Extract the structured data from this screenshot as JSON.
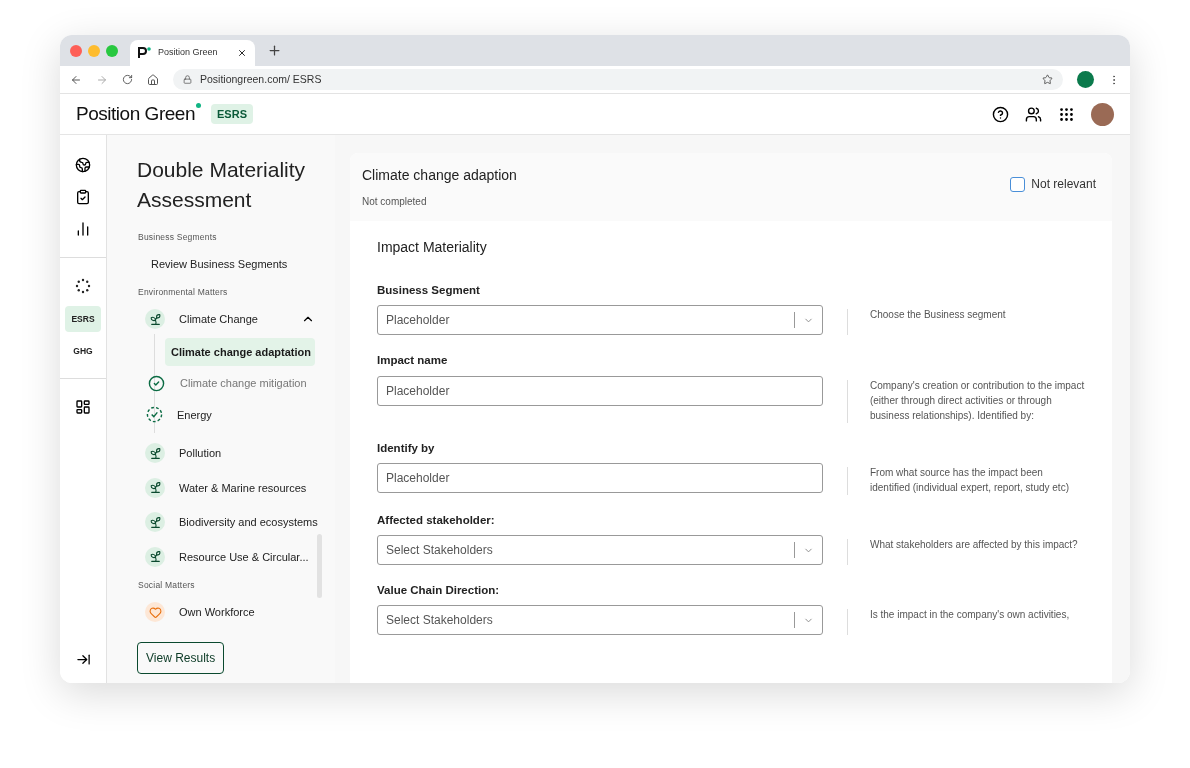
{
  "browser": {
    "tab_title": "Position Green",
    "url": "Positiongreen.com/ ESRS"
  },
  "header": {
    "logo": "Position Green",
    "product_badge": "ESRS"
  },
  "rail": {
    "modules": [
      {
        "label": "ESRS",
        "selected": true
      },
      {
        "label": "GHG",
        "selected": false
      }
    ]
  },
  "sidebar": {
    "title": "Double Materiality Assessment",
    "sections": [
      {
        "heading": "Business Segments",
        "items": [
          {
            "label": "Review Business Segments",
            "kind": "plain",
            "selected": false
          }
        ]
      },
      {
        "heading": "Environmental Matters",
        "items": [
          {
            "label": "Climate Change",
            "kind": "topic",
            "selected": false,
            "expanded": true,
            "children": [
              {
                "label": "Climate change adaptation",
                "kind": "plain",
                "selected": true
              },
              {
                "label": "Climate change mitigation",
                "kind": "done",
                "selected": false
              },
              {
                "label": "Energy",
                "kind": "partial",
                "selected": false
              }
            ]
          },
          {
            "label": "Pollution",
            "kind": "topic",
            "selected": false
          },
          {
            "label": "Water & Marine resources",
            "kind": "topic",
            "selected": false
          },
          {
            "label": "Biodiversity and ecosystems",
            "kind": "topic",
            "selected": false
          },
          {
            "label": "Resource Use & Circular...",
            "kind": "topic",
            "selected": false
          }
        ]
      },
      {
        "heading": "Social Matters",
        "items": [
          {
            "label": "Own Workforce",
            "kind": "social",
            "selected": false
          }
        ]
      }
    ],
    "button": "View Results"
  },
  "panel": {
    "title": "Climate change adaption",
    "status": "Not completed",
    "not_relevant": {
      "label": "Not relevant",
      "checked": false
    },
    "section_title": "Impact Materiality",
    "fields": [
      {
        "label": "Business Segment",
        "kind": "select",
        "placeholder": "Placeholder",
        "hint": "Choose the Business segment"
      },
      {
        "label": "Impact name",
        "kind": "text",
        "placeholder": "Placeholder",
        "hint": "Company's creation or contribution to the impact (either through direct activities or through business relationships). Identified by:"
      },
      {
        "label": "Identify by",
        "kind": "text",
        "placeholder": "Placeholder",
        "hint": "From what source has the impact been identified (individual expert, report, study etc)"
      },
      {
        "label": "Affected stakeholder:",
        "kind": "select",
        "placeholder": "Select Stakeholders",
        "hint": "What stakeholders are affected by this impact?"
      },
      {
        "label": "Value Chain Direction:",
        "kind": "select",
        "placeholder": "Select Stakeholders",
        "hint": "Is the impact in the company's own activities,"
      }
    ]
  }
}
